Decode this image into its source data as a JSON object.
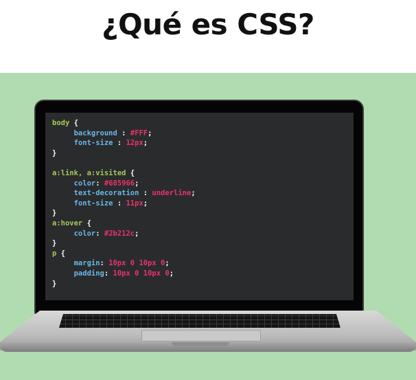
{
  "title": "¿Qué es CSS?",
  "code_lines": [
    [
      {
        "t": "body",
        "c": "sel"
      },
      {
        "t": " {",
        "c": "punc"
      }
    ],
    [
      {
        "t": "     background",
        "c": "prop"
      },
      {
        "t": " : ",
        "c": "punc"
      },
      {
        "t": "#FFF",
        "c": "val"
      },
      {
        "t": ";",
        "c": "punc"
      }
    ],
    [
      {
        "t": "     font-size",
        "c": "prop"
      },
      {
        "t": " : ",
        "c": "punc"
      },
      {
        "t": "12px",
        "c": "val"
      },
      {
        "t": ";",
        "c": "punc"
      }
    ],
    [
      {
        "t": "}",
        "c": "punc"
      }
    ],
    [
      {
        "t": "",
        "c": "punc"
      }
    ],
    [
      {
        "t": "a:link, a:visited",
        "c": "sel"
      },
      {
        "t": " {",
        "c": "punc"
      }
    ],
    [
      {
        "t": "     color",
        "c": "prop"
      },
      {
        "t": ": ",
        "c": "punc"
      },
      {
        "t": "#685966",
        "c": "val"
      },
      {
        "t": ";",
        "c": "punc"
      }
    ],
    [
      {
        "t": "     text-decoration",
        "c": "prop"
      },
      {
        "t": " : ",
        "c": "punc"
      },
      {
        "t": "underline",
        "c": "val"
      },
      {
        "t": ";",
        "c": "punc"
      }
    ],
    [
      {
        "t": "     font-size",
        "c": "prop"
      },
      {
        "t": " : ",
        "c": "punc"
      },
      {
        "t": "11px",
        "c": "val"
      },
      {
        "t": ";",
        "c": "punc"
      }
    ],
    [
      {
        "t": "}",
        "c": "punc"
      }
    ],
    [
      {
        "t": "a:hover",
        "c": "sel"
      },
      {
        "t": " {",
        "c": "punc"
      }
    ],
    [
      {
        "t": "     color",
        "c": "prop"
      },
      {
        "t": ": ",
        "c": "punc"
      },
      {
        "t": "#2b212c",
        "c": "val"
      },
      {
        "t": ";",
        "c": "punc"
      }
    ],
    [
      {
        "t": "}",
        "c": "punc"
      }
    ],
    [
      {
        "t": "p",
        "c": "sel"
      },
      {
        "t": " {",
        "c": "punc"
      }
    ],
    [
      {
        "t": "     margin",
        "c": "prop"
      },
      {
        "t": ": ",
        "c": "punc"
      },
      {
        "t": "10px 0 10px 0",
        "c": "val"
      },
      {
        "t": ";",
        "c": "punc"
      }
    ],
    [
      {
        "t": "     padding",
        "c": "prop"
      },
      {
        "t": ": ",
        "c": "punc"
      },
      {
        "t": "10px 0 10px 0",
        "c": "val"
      },
      {
        "t": ";",
        "c": "punc"
      }
    ],
    [
      {
        "t": "}",
        "c": "punc"
      }
    ]
  ],
  "colors": {
    "background": "#b1dbb0",
    "screen": "#2a2b2c",
    "selector": "#a6c95a",
    "property": "#6ab8e8",
    "value": "#e8336e"
  }
}
